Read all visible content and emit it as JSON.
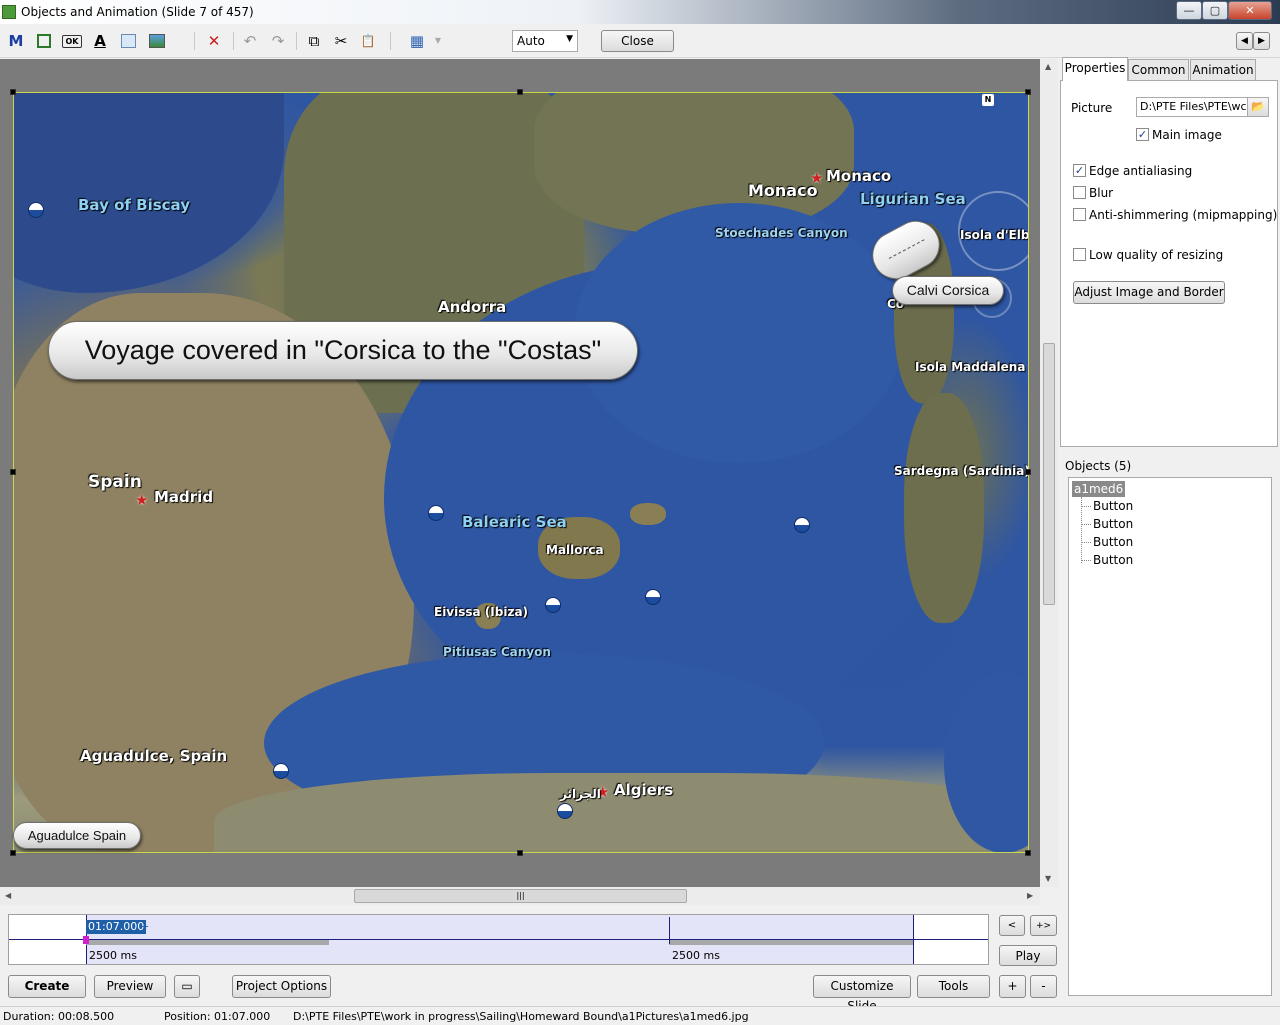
{
  "window": {
    "title": "Objects and Animation  (Slide 7 of 457)",
    "min_label": "—",
    "max_label": "▢",
    "close_label": "✕"
  },
  "toolbar": {
    "zoom_value": "Auto",
    "close_label": "Close",
    "icons": [
      "text-m-icon",
      "frame-icon",
      "ok-button-icon",
      "text-a-icon",
      "rectangle-icon",
      "image-icon",
      "delete-icon",
      "undo-icon",
      "redo-icon",
      "copy-icon",
      "cut-icon",
      "paste-icon",
      "grid-icon"
    ],
    "icon_glyphs": {
      "m": "M",
      "ok": "OK",
      "a": "A",
      "delete": "✕",
      "undo": "↶",
      "redo": "↷",
      "copy": "⧉",
      "cut": "✂",
      "paste": "📋",
      "grid": "▦"
    },
    "prev_label": "◀",
    "next_label": "▶"
  },
  "map": {
    "labels": {
      "bay_of_biscay": "Bay of Biscay",
      "monaco_big": "Monaco",
      "monaco": "Monaco",
      "ligurian_sea": "Ligurian Sea",
      "stoechades": "Stoechades Canyon",
      "isola_elba": "Isola d'Elb",
      "andorra": "Andorra",
      "isola_maddalena": "Isola Maddalena",
      "spain": "Spain",
      "madrid": "Madrid",
      "balearic_sea": "Balearic Sea",
      "mallorca": "Mallorca",
      "sardegna": "Sardegna (Sardinia)",
      "eivissa": "Eivissa (Ibiza)",
      "pitiusas": "Pitiusas Canyon",
      "aguadulce_map": "Aguadulce, Spain",
      "algiers": "Algiers",
      "algiers_ar": "الجزائر",
      "calvi_under": "Co"
    },
    "compass_n": "N"
  },
  "captions": {
    "voyage": "Voyage covered in \"Corsica to the \"Costas\"",
    "calvi": "Calvi Corsica",
    "aguadulce": "Aguadulce Spain"
  },
  "timeline": {
    "current_time": "01:07.000",
    "plus": "+",
    "duration1": "2500 ms",
    "duration2": "2500 ms",
    "prev_label": "<",
    "both_label": "+>",
    "play_label": "Play"
  },
  "buttons": {
    "create": "Create",
    "preview": "Preview",
    "screen_icon": "▭",
    "project_options": "Project Options",
    "customize_slide": "Customize Slide",
    "tools": "Tools",
    "plus": "+",
    "minus": "-"
  },
  "status": {
    "duration": "Duration:  00:08.500",
    "position": "Position:  01:07.000",
    "path": "D:\\PTE Files\\PTE\\work in progress\\Sailing\\Homeward Bound\\a1Pictures\\a1med6.jpg"
  },
  "properties": {
    "tabs": [
      "Properties",
      "Common",
      "Animation"
    ],
    "picture_label": "Picture",
    "picture_value": "D:\\PTE Files\\PTE\\wc",
    "browse_icon": "📂",
    "main_image": {
      "label": "Main image",
      "checked": true
    },
    "edge_antialiasing": {
      "label": "Edge antialiasing",
      "checked": true
    },
    "blur": {
      "label": "Blur",
      "checked": false
    },
    "anti_shimmering": {
      "label": "Anti-shimmering (mipmapping)",
      "checked": false
    },
    "low_quality": {
      "label": "Low quality of resizing",
      "checked": false
    },
    "adjust_button": "Adjust Image and Border",
    "check_mark": "✓"
  },
  "objects": {
    "header": "Objects (5)",
    "root": "a1med6",
    "children": [
      "Button",
      "Button",
      "Button",
      "Button"
    ]
  },
  "scroll": {
    "up": "▲",
    "down": "▼",
    "left": "◀",
    "right": "▶",
    "grip": "|||"
  }
}
